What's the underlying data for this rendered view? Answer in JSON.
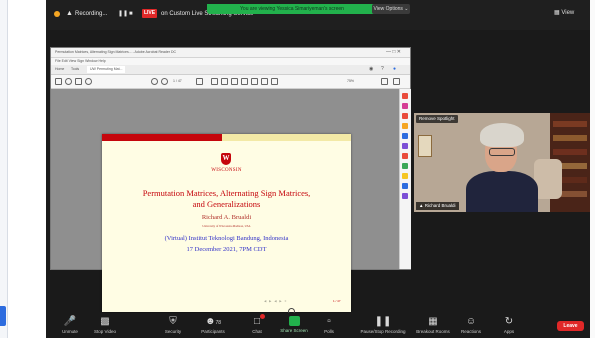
{
  "topbar": {
    "recording_label": "Recording...",
    "live_badge": "LIVE",
    "live_text": "on Custom Live Streaming Service",
    "viewing_banner": "You are viewing Yessica Simariyeman's screen",
    "view_options": "View Options",
    "view_button": "View"
  },
  "pdf": {
    "window_title": "Permutation Matrices, Alternating Sign Matrices... - Adobe Acrobat Reader DC",
    "menu": "File  Edit  View  Sign  Window  Help",
    "tabs": [
      "Home",
      "Tools",
      "UW Permuting Mat..."
    ],
    "page_indicator": "1 / 47",
    "zoom": "75%"
  },
  "slide": {
    "university": "WISCONSIN",
    "title_line1": "Permutation Matrices, Alternating Sign Matrices,",
    "title_line2": "and Generalizations",
    "author": "Richard A. Brualdi",
    "affiliation": "University of Wisconsin-Madison, USA",
    "event_line1": "(Virtual) Institut Teknologi Bandung, Indonesia",
    "event_line2": "17 December 2021, 7PM CDT",
    "page_num": "1 / 47"
  },
  "video": {
    "spotlight_button": "Remove Spotlight",
    "participant_name": "Richard Brualdi"
  },
  "controls": {
    "unmute": "Unmute",
    "stop_video": "Stop Video",
    "security": "Security",
    "participants": "Participants",
    "participants_count": "78",
    "chat": "Chat",
    "share_screen": "Share Screen",
    "polls": "Polls",
    "pause_recording": "Pause/Stop Recording",
    "breakout_rooms": "Breakout Rooms",
    "reactions": "Reactions",
    "apps": "Apps",
    "leave": "Leave"
  },
  "colors": {
    "zoom_bg": "#1a1a1a",
    "banner_green": "#22b14c",
    "leave_red": "#e02828",
    "uw_red": "#c5050c",
    "slide_blue": "#3333c8",
    "slide_bg": "#fffde4"
  }
}
